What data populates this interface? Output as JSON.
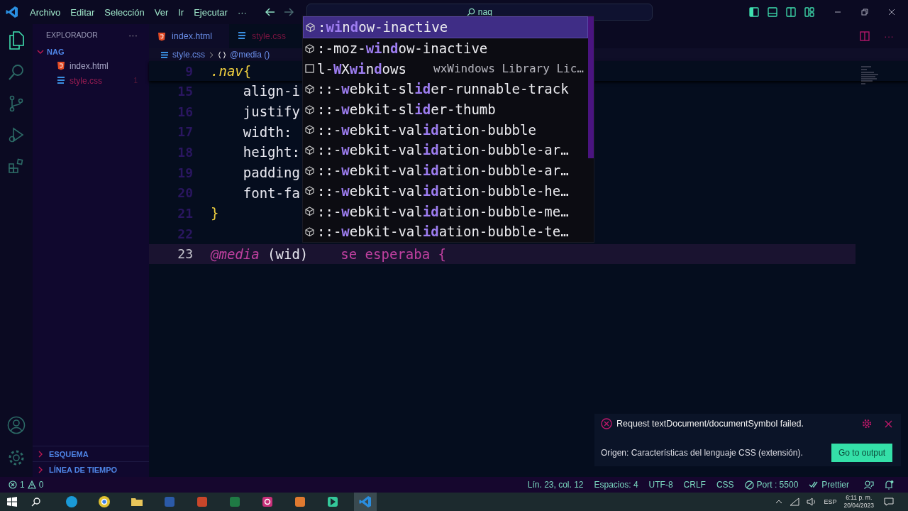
{
  "title_bar": {
    "menu": [
      "Archivo",
      "Editar",
      "Selección",
      "Ver",
      "Ir",
      "Ejecutar"
    ],
    "more": "···",
    "search": {
      "value": "nag"
    }
  },
  "tabs": [
    {
      "label": "index.html",
      "kind": "html",
      "selected": false
    },
    {
      "label": "style.css",
      "kind": "css",
      "selected": true
    }
  ],
  "breadcrumb": [
    {
      "label": "style.css",
      "kind": "css"
    },
    {
      "label": "@media ()",
      "kind": "symbol"
    }
  ],
  "explorer": {
    "title": "EXPLORADOR",
    "more": "···",
    "folder": {
      "label": "NAG",
      "expanded": true,
      "children": [
        {
          "label": "index.html",
          "kind": "html",
          "error": false
        },
        {
          "label": "style.css",
          "kind": "css",
          "error": true,
          "badge": "1"
        }
      ]
    }
  },
  "sections": [
    {
      "label": "ESQUEMA",
      "expanded": false
    },
    {
      "label": "LÍNEA DE TIEMPO",
      "expanded": false
    }
  ],
  "editor": {
    "sticky": {
      "number": "9",
      "tokens": [
        {
          "text": ".nav",
          "kind": "selector"
        },
        {
          "text": "{",
          "kind": "brace"
        }
      ]
    },
    "lines": [
      {
        "number": "15",
        "current": false,
        "tokens": [
          {
            "text": "    align-i",
            "kind": "plain"
          }
        ]
      },
      {
        "number": "16",
        "current": false,
        "tokens": [
          {
            "text": "    justify",
            "kind": "plain"
          }
        ]
      },
      {
        "number": "17",
        "current": false,
        "tokens": [
          {
            "text": "    width:",
            "kind": "plain"
          }
        ]
      },
      {
        "number": "18",
        "current": false,
        "tokens": [
          {
            "text": "    height:",
            "kind": "plain"
          }
        ]
      },
      {
        "number": "19",
        "current": false,
        "tokens": [
          {
            "text": "    padding",
            "kind": "plain"
          }
        ]
      },
      {
        "number": "20",
        "current": false,
        "tokens": [
          {
            "text": "    font-fa",
            "kind": "plain"
          }
        ]
      },
      {
        "number": "21",
        "current": false,
        "tokens": [
          {
            "text": "}",
            "kind": "brace"
          }
        ]
      },
      {
        "number": "22",
        "current": false
      },
      {
        "number": "23",
        "current": true,
        "tokens": [
          {
            "text": "@media",
            "kind": "keyword"
          },
          {
            "text": " (wid)",
            "kind": "plain"
          }
        ],
        "hint": "se esperaba {"
      }
    ]
  },
  "suggestions": [
    {
      "label": ":**wi**n**d**ow-inactive",
      "kind": "property",
      "selected": true
    },
    {
      "label": ":-moz-**wi**n**d**ow-inactive",
      "kind": "property",
      "selected": false
    },
    {
      "label": "l-**W**X**wi**n**d**ows",
      "kind": "word",
      "selected": false,
      "detail": "wxWindows Library Lic…"
    },
    {
      "label": "::-**w**ebkit-sl**id**er-runnable-track",
      "kind": "property",
      "selected": false
    },
    {
      "label": "::-**w**ebkit-sl**id**er-thumb",
      "kind": "property",
      "selected": false
    },
    {
      "label": "::-**w**ebkit-val**id**ation-bubble",
      "kind": "property",
      "selected": false
    },
    {
      "label": "::-**w**ebkit-val**id**ation-bubble-ar…",
      "kind": "property",
      "selected": false
    },
    {
      "label": "::-**w**ebkit-val**id**ation-bubble-ar…",
      "kind": "property",
      "selected": false
    },
    {
      "label": "::-**w**ebkit-val**id**ation-bubble-he…",
      "kind": "property",
      "selected": false
    },
    {
      "label": "::-**w**ebkit-val**id**ation-bubble-me…",
      "kind": "property",
      "selected": false
    },
    {
      "label": "::-**w**ebkit-val**id**ation-bubble-te…",
      "kind": "property",
      "selected": false
    }
  ],
  "notification": {
    "kind": "error",
    "message": "Request textDocument/documentSymbol failed.",
    "source": "Origen: Características del lenguaje CSS (extensión).",
    "button": "Go to output"
  },
  "status_bar": {
    "errors": "1",
    "warnings": "0",
    "items": [
      {
        "text": "Lín. 23, col. 12",
        "kind": "plain"
      },
      {
        "text": "Espacios: 4",
        "kind": "plain"
      },
      {
        "text": "UTF-8",
        "kind": "plain"
      },
      {
        "text": "CRLF",
        "kind": "plain"
      },
      {
        "text": "CSS",
        "kind": "plain"
      },
      {
        "text": "Port : 5500",
        "kind": "port"
      },
      {
        "text": "Prettier",
        "kind": "check"
      }
    ]
  },
  "taskbar": {
    "language": "ESP",
    "time": "6:11 p. m.",
    "date": "20/04/2023"
  }
}
